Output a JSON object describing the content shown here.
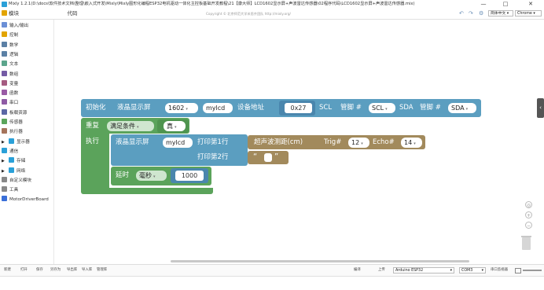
{
  "window": {
    "title": "Mixly 1.2.1(D:\\docs\\软件技术文档\\整理\\嵌入式开发\\Mixly\\Mixly图形化编程ESP32电机驱动一体化主控板基础开发教程\\21【康大师】LCD1602显示屏+声波雷达传感器\\02程序代码\\LCD1602显示屏+声波雷达传感器.mix)",
    "min": "—",
    "max": "□",
    "close": "✕"
  },
  "toolbar": {
    "modules_label": "模块",
    "code_tab": "代码",
    "copyright": "Copyright © 北京师范大学米思齐团队 http://mixly.org/",
    "lang_select": "简体中文",
    "theme_select": "Chrome"
  },
  "sidebar": {
    "items": [
      {
        "label": "输入/输出",
        "color": "#6b8fd6",
        "icon": "io-icon"
      },
      {
        "label": "控制",
        "color": "#e2a400",
        "icon": "control-icon"
      },
      {
        "label": "数学",
        "color": "#5b80a5",
        "icon": "math-icon"
      },
      {
        "label": "逻辑",
        "color": "#5b80a5",
        "icon": "logic-icon"
      },
      {
        "label": "文本",
        "color": "#5ba58c",
        "icon": "text-icon"
      },
      {
        "label": "数组",
        "color": "#745ba5",
        "icon": "array-icon"
      },
      {
        "label": "变量",
        "color": "#a55b80",
        "icon": "variable-icon"
      },
      {
        "label": "函数",
        "color": "#995ba5",
        "icon": "function-icon"
      },
      {
        "label": "串口",
        "color": "#8e5ba5",
        "icon": "serial-icon"
      },
      {
        "label": "板载资源",
        "color": "#5b67a5",
        "icon": "board-icon"
      },
      {
        "label": "传感器",
        "color": "#5ba55b",
        "icon": "sensor-icon"
      },
      {
        "label": "执行器",
        "color": "#a5745b",
        "icon": "actuator-icon"
      },
      {
        "label": "显示器",
        "color": "#2aa0d8",
        "icon": "display-icon",
        "arrow": "▶"
      },
      {
        "label": "通信",
        "color": "#2aa0d8",
        "icon": "comm-icon"
      },
      {
        "label": "存储",
        "color": "#2aa0d8",
        "icon": "storage-icon",
        "arrow": "▶"
      },
      {
        "label": "网络",
        "color": "#2aa0d8",
        "icon": "network-icon",
        "arrow": "▶"
      },
      {
        "label": "自定义模块",
        "color": "#888888",
        "icon": "custom-icon"
      },
      {
        "label": "工具",
        "color": "#888888",
        "icon": "tools-icon"
      },
      {
        "label": "MotorDriverBoard",
        "color": "#3a6fd8",
        "icon": "motor-icon"
      }
    ]
  },
  "blocks": {
    "init": {
      "label": "初始化",
      "device": "液晶显示屏",
      "model": "1602",
      "name": "mylcd",
      "addr_label": "设备地址",
      "addr": "0x27",
      "scl_label": "SCL",
      "pin_label1": "管脚 #",
      "scl": "SCL",
      "sda_label": "SDA",
      "pin_label2": "管脚 #",
      "sda": "SDA"
    },
    "repeat": {
      "label": "重复",
      "mode": "满足条件",
      "cond": "真"
    },
    "exec": {
      "label": "执行",
      "lcd": "液晶显示屏",
      "lcd_name": "mylcd",
      "print1": "打印第1行",
      "print2": "打印第2行",
      "ultra": "超声波测距(cm)",
      "trig_label": "Trig#",
      "trig": "12",
      "echo_label": "Echo#",
      "echo": "14",
      "quote_open": "“",
      "quote_close": "”",
      "delay_label": "延时",
      "delay_unit": "毫秒",
      "delay_value": "1000"
    }
  },
  "status": {
    "buttons": [
      "新建",
      "打开",
      "保存",
      "另存为",
      "导出库",
      "导入库",
      "管理库"
    ],
    "compile": "编译",
    "upload": "上传",
    "board": "Arduino ESP32",
    "port": "COM3",
    "serial_monitor": "串口监视器"
  },
  "colors": {
    "init_block": "#5b9ec0",
    "loop_block": "#5ba35b",
    "sensor_block": "#a28a5c"
  }
}
